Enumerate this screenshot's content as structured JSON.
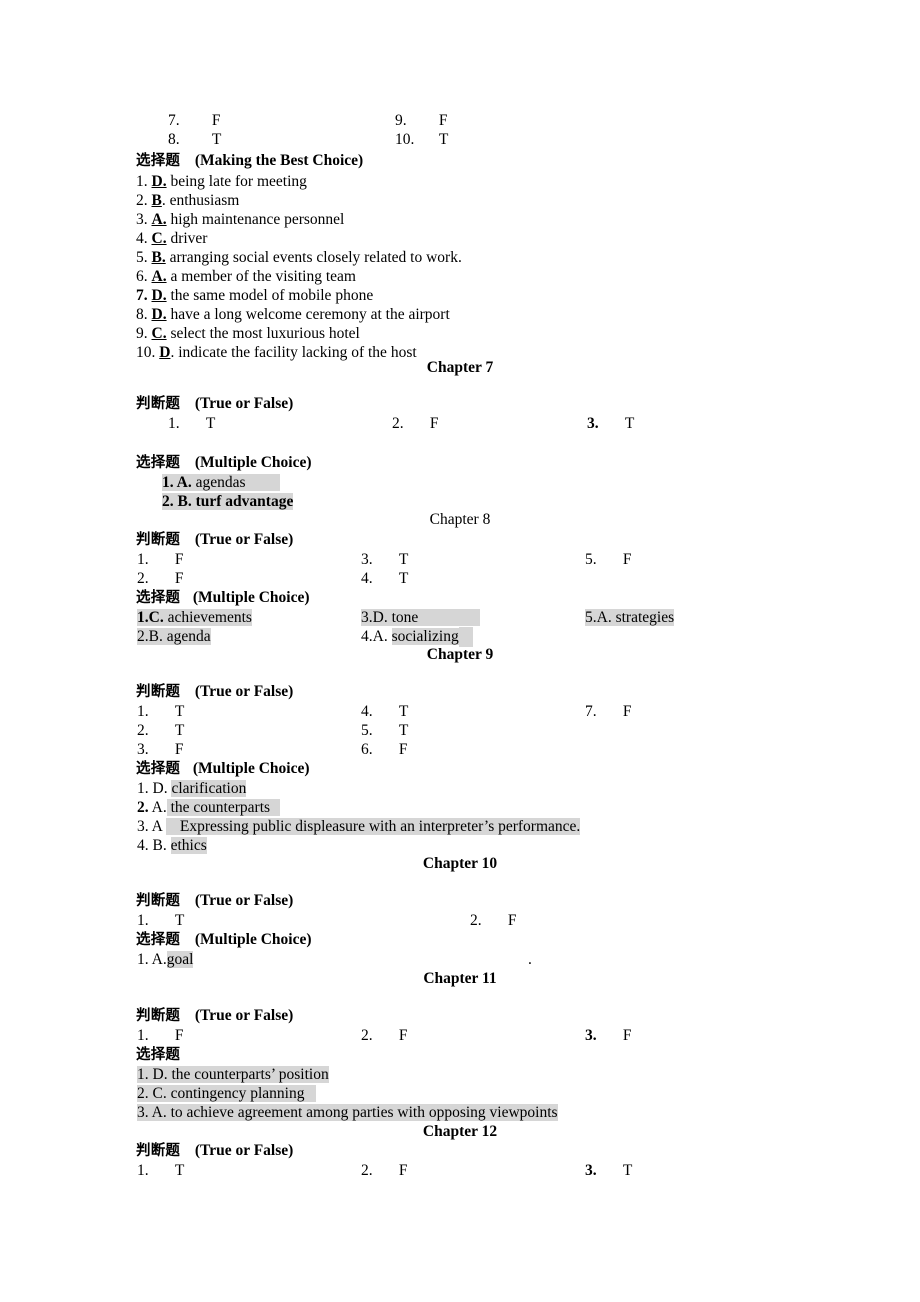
{
  "document": {
    "type": "answer-key",
    "highlight_color": "#d6d6d6",
    "text_color": "#000000",
    "page_background": "#ffffff"
  },
  "chapter6_tail": {
    "true_false_rows": [
      {
        "left_num": "7.",
        "left_val": "F",
        "right_num": "9.",
        "right_val": "F"
      },
      {
        "left_num": "8.",
        "left_val": "T",
        "right_num": "10.",
        "right_val": "T"
      }
    ],
    "choice_heading_cjk": "选择题",
    "choice_heading_en": "(Making the Best Choice)",
    "choices": [
      {
        "num": "1.",
        "num_bold": false,
        "letter": "D.",
        "text": "being late for meeting"
      },
      {
        "num": "2.",
        "num_bold": false,
        "letter": "B",
        "letter_tail": ".",
        "text": "enthusiasm"
      },
      {
        "num": "3.",
        "num_bold": false,
        "letter": "A.",
        "text": "high maintenance personnel"
      },
      {
        "num": "4.",
        "num_bold": false,
        "letter": "C.",
        "text": "driver"
      },
      {
        "num": "5.",
        "num_bold": false,
        "letter": "B.",
        "text": "arranging social events closely related to work."
      },
      {
        "num": "6.",
        "num_bold": false,
        "letter": "A.",
        "text": "a member of the visiting team"
      },
      {
        "num": "7.",
        "num_bold": true,
        "letter": "D.",
        "text": "the same model of mobile phone"
      },
      {
        "num": "8.",
        "num_bold": false,
        "letter": "D.",
        "text": "have a long welcome ceremony at the airport"
      },
      {
        "num": "9.",
        "num_bold": false,
        "letter": "C.",
        "text": "select the most luxurious hotel"
      },
      {
        "num": "10.",
        "num_bold": false,
        "letter": "D",
        "letter_tail": ".",
        "text": "indicate the facility lacking of the host"
      }
    ]
  },
  "chapter7": {
    "title": "Chapter 7",
    "tf_heading_cjk": "判断题",
    "tf_heading_en": "(True or False)",
    "tf_row": {
      "n1": "1.",
      "v1": "T",
      "n2": "2.",
      "v2": "F",
      "n3": "3.",
      "v3": "T",
      "n3_bold": true
    },
    "mc_heading_cjk": "选择题",
    "mc_heading_en": "(Multiple Choice)",
    "choices": [
      {
        "bold_part": "1. A.",
        "plain_part": "agendas",
        "all_bold": false
      },
      {
        "bold_part": "2. B. turf advantage",
        "plain_part": "",
        "all_bold": true
      }
    ]
  },
  "chapter8": {
    "title": "Chapter 8",
    "tf_heading_cjk": "判断题",
    "tf_heading_en": "(True or False)",
    "tf_rows": [
      {
        "n1": "1.",
        "v1": "F",
        "n2": "3.",
        "v2": "T",
        "n3": "5.",
        "v3": "F"
      },
      {
        "n1": "2.",
        "v1": "F",
        "n2": "4.",
        "v2": "T",
        "n3": "",
        "v3": ""
      }
    ],
    "mc_heading_cjk": "选择题",
    "mc_heading_en": "(Multiple Choice)",
    "mc_rows": [
      {
        "c1_bold": "1.C.",
        "c1_text": "achievements",
        "c2_bold": "3.D.",
        "c2_text": "tone",
        "c3_bold": "",
        "c3_text": "5.A. strategies"
      },
      {
        "c1_bold": "",
        "c1_text": "2.B. agenda",
        "c2_bold": "",
        "c2_text": "4.A.",
        "c2_text2": "socializing",
        "c3_bold": "",
        "c3_text": ""
      }
    ]
  },
  "chapter9": {
    "title": "Chapter 9",
    "tf_heading_cjk": "判断题",
    "tf_heading_en": "(True or False)",
    "tf_rows": [
      {
        "n1": "1.",
        "v1": "T",
        "n2": "4.",
        "v2": "T",
        "n3": "7.",
        "v3": "F"
      },
      {
        "n1": "2.",
        "v1": "T",
        "n2": "5.",
        "v2": "T",
        "n3": "",
        "v3": ""
      },
      {
        "n1": "3.",
        "v1": "F",
        "n2": "6.",
        "v2": "F",
        "n3": "",
        "v3": ""
      }
    ],
    "mc_heading_cjk": "选择题",
    "mc_heading_en": "(Multiple Choice)",
    "choices": [
      {
        "lead": "1. D.",
        "lead_bold": false,
        "text": "clarification"
      },
      {
        "lead": "2.",
        "lead_bold": true,
        "lead2": "A.",
        "text": "the counterparts"
      },
      {
        "lead": "3. A",
        "lead_bold": false,
        "text": "Expressing public displeasure with an interpreter’s performance."
      },
      {
        "lead": "4. B.",
        "lead_bold": false,
        "text": "ethics"
      }
    ]
  },
  "chapter10": {
    "title": "Chapter 10",
    "tf_heading_cjk": "判断题",
    "tf_heading_en": "(True or False)",
    "tf_row": {
      "n1": "1.",
      "v1": "T",
      "n2": "2.",
      "v2": "F"
    },
    "mc_heading_cjk": "选择题",
    "mc_heading_en": "(Multiple Choice)",
    "choices": [
      {
        "lead": "1. A.",
        "text": "goal"
      }
    ],
    "stray_mark": "."
  },
  "chapter11": {
    "title": "Chapter 11",
    "tf_heading_cjk": "判断题",
    "tf_heading_en": "(True or False)",
    "tf_row": {
      "n1": "1.",
      "v1": "F",
      "n2": "2.",
      "v2": "F",
      "n3": "3.",
      "v3": "F",
      "n3_bold": true
    },
    "mc_heading_cjk": "选择题",
    "mc_heading_en": "",
    "choices": [
      {
        "text": "1. D. the counterparts’ position"
      },
      {
        "text": "2. C. contingency planning"
      },
      {
        "text": "3. A. to achieve agreement among parties with opposing viewpoints"
      }
    ]
  },
  "chapter12": {
    "title": "Chapter 12",
    "tf_heading_cjk": "判断题",
    "tf_heading_en": "(True or False)",
    "tf_row": {
      "n1": "1.",
      "v1": "T",
      "n2": "2.",
      "v2": "F",
      "n3": "3.",
      "v3": "T",
      "n3_bold": true
    }
  }
}
